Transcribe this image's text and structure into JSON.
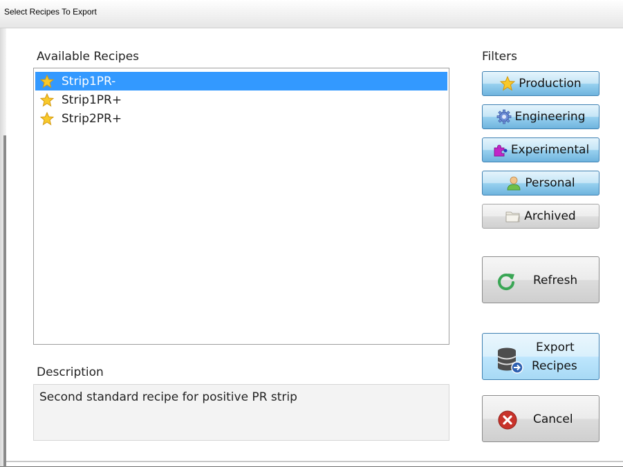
{
  "window": {
    "title": "Select Recipes To Export"
  },
  "recipes": {
    "heading": "Available Recipes",
    "items": [
      {
        "label": "Strip1PR-",
        "selected": true,
        "icon": "star-icon"
      },
      {
        "label": "Strip1PR+",
        "selected": false,
        "icon": "star-icon"
      },
      {
        "label": "Strip2PR+",
        "selected": false,
        "icon": "star-icon"
      }
    ]
  },
  "description": {
    "heading": "Description",
    "text": "Second standard recipe for positive PR strip"
  },
  "filters": {
    "heading": "Filters",
    "buttons": [
      {
        "label": "Production",
        "icon": "star-icon",
        "active": true
      },
      {
        "label": "Engineering",
        "icon": "gear-icon",
        "active": true
      },
      {
        "label": "Experimental",
        "icon": "puzzle-icon",
        "active": true
      },
      {
        "label": "Personal",
        "icon": "user-icon",
        "active": true
      },
      {
        "label": "Archived",
        "icon": "folder-icon",
        "active": false
      }
    ]
  },
  "actions": {
    "refresh_label": "Refresh",
    "export_label_line1": "Export",
    "export_label_line2": "Recipes",
    "cancel_label": "Cancel"
  },
  "colors": {
    "selection": "#3399ff",
    "filter_active": "#98d1ef",
    "cancel_red": "#c8332b",
    "refresh_green": "#3aa655"
  }
}
